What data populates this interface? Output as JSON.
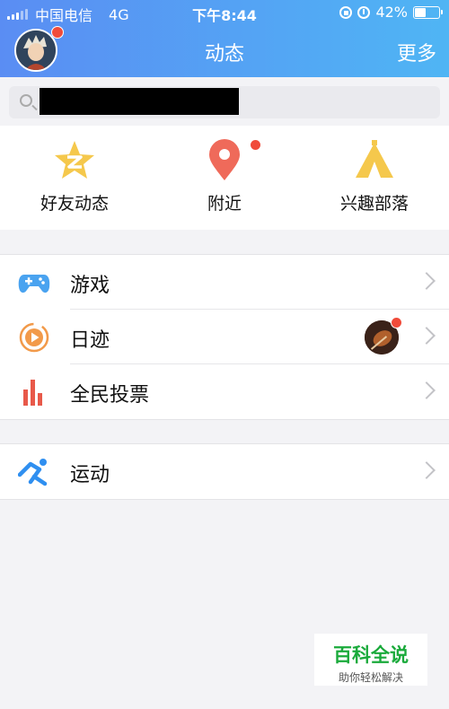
{
  "status_bar": {
    "carrier": "中国电信",
    "network": "4G",
    "time": "下午8:44",
    "battery_percent": "42%",
    "battery_level": 0.42
  },
  "nav": {
    "title": "动态",
    "more_label": "更多"
  },
  "shortcuts": [
    {
      "label": "好友动态",
      "icon": "friends-feed-icon",
      "color": "#f5c84c",
      "badge": false
    },
    {
      "label": "附近",
      "icon": "location-pin-icon",
      "color": "#ef6a5a",
      "badge": true
    },
    {
      "label": "兴趣部落",
      "icon": "tent-icon",
      "color": "#f5c84c",
      "badge": false
    }
  ],
  "menu_group_1": [
    {
      "label": "游戏",
      "icon": "gamepad-icon",
      "color": "#4aa3f0"
    },
    {
      "label": "日迹",
      "icon": "daily-trace-icon",
      "color": "#f29a4a"
    },
    {
      "label": "全民投票",
      "icon": "poll-bars-icon",
      "color": "#e8594a"
    }
  ],
  "menu_group_2": [
    {
      "label": "运动",
      "icon": "running-icon",
      "color": "#2f8ff0"
    }
  ],
  "watermark": {
    "title": "百科全说",
    "subtitle": "助你轻松解决"
  },
  "colors": {
    "header_start": "#5a8df3",
    "header_end": "#4fb5f4",
    "badge_red": "#f04b3a"
  }
}
